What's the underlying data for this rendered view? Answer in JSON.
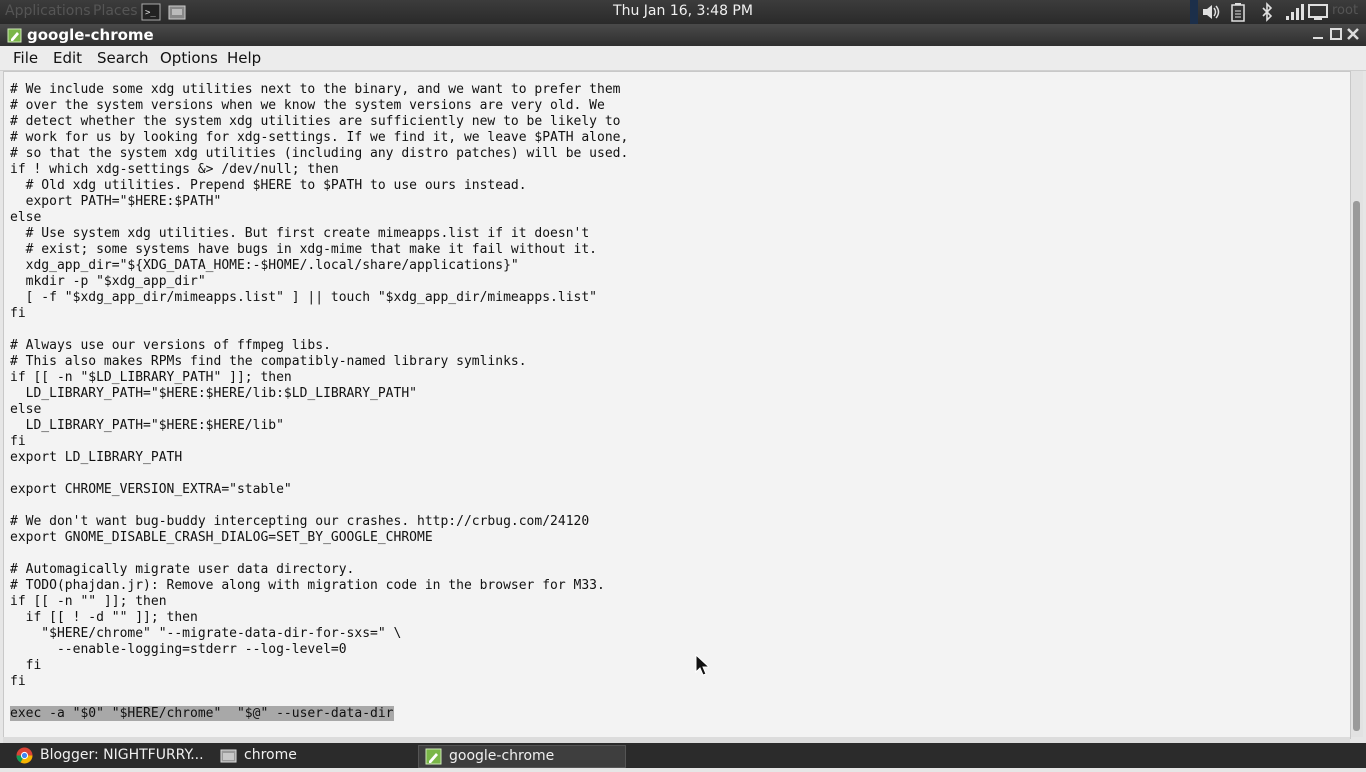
{
  "top_panel": {
    "applications": "Applications",
    "places": "Places",
    "clock": "Thu Jan 16,  3:48 PM",
    "user": "root",
    "tray_icons": [
      "volume-icon",
      "battery-icon",
      "bluetooth-icon",
      "network-signal-icon",
      "display-icon"
    ]
  },
  "window": {
    "title": "google-chrome"
  },
  "menubar": {
    "file": "File",
    "edit": "Edit",
    "search": "Search",
    "options": "Options",
    "help": "Help"
  },
  "editor": {
    "lines": [
      "# We include some xdg utilities next to the binary, and we want to prefer them",
      "# over the system versions when we know the system versions are very old. We",
      "# detect whether the system xdg utilities are sufficiently new to be likely to",
      "# work for us by looking for xdg-settings. If we find it, we leave $PATH alone,",
      "# so that the system xdg utilities (including any distro patches) will be used.",
      "if ! which xdg-settings &> /dev/null; then",
      "  # Old xdg utilities. Prepend $HERE to $PATH to use ours instead.",
      "  export PATH=\"$HERE:$PATH\"",
      "else",
      "  # Use system xdg utilities. But first create mimeapps.list if it doesn't",
      "  # exist; some systems have bugs in xdg-mime that make it fail without it.",
      "  xdg_app_dir=\"${XDG_DATA_HOME:-$HOME/.local/share/applications}\"",
      "  mkdir -p \"$xdg_app_dir\"",
      "  [ -f \"$xdg_app_dir/mimeapps.list\" ] || touch \"$xdg_app_dir/mimeapps.list\"",
      "fi",
      "",
      "# Always use our versions of ffmpeg libs.",
      "# This also makes RPMs find the compatibly-named library symlinks.",
      "if [[ -n \"$LD_LIBRARY_PATH\" ]]; then",
      "  LD_LIBRARY_PATH=\"$HERE:$HERE/lib:$LD_LIBRARY_PATH\"",
      "else",
      "  LD_LIBRARY_PATH=\"$HERE:$HERE/lib\"",
      "fi",
      "export LD_LIBRARY_PATH",
      "",
      "export CHROME_VERSION_EXTRA=\"stable\"",
      "",
      "# We don't want bug-buddy intercepting our crashes. http://crbug.com/24120",
      "export GNOME_DISABLE_CRASH_DIALOG=SET_BY_GOOGLE_CHROME",
      "",
      "# Automagically migrate user data directory.",
      "# TODO(phajdan.jr): Remove along with migration code in the browser for M33.",
      "if [[ -n \"\" ]]; then",
      "  if [[ ! -d \"\" ]]; then",
      "    \"$HERE/chrome\" \"--migrate-data-dir-for-sxs=\" \\",
      "      --enable-logging=stderr --log-level=0",
      "  fi",
      "fi",
      ""
    ],
    "selected_line": "exec -a \"$0\" \"$HERE/chrome\"  \"$@\" --user-data-dir"
  },
  "taskbar": {
    "tasks": [
      {
        "label": "Blogger: NIGHTFURRY...",
        "icon": "chrome-icon"
      },
      {
        "label": "chrome",
        "icon": "folder-icon"
      },
      {
        "label": "google-chrome",
        "icon": "text-editor-icon"
      }
    ]
  }
}
